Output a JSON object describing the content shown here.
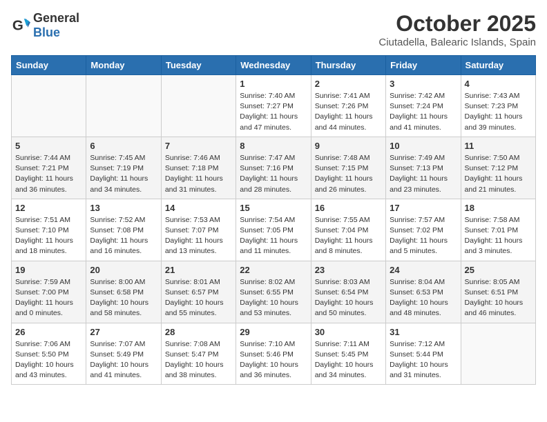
{
  "header": {
    "logo_general": "General",
    "logo_blue": "Blue",
    "month": "October 2025",
    "location": "Ciutadella, Balearic Islands, Spain"
  },
  "weekdays": [
    "Sunday",
    "Monday",
    "Tuesday",
    "Wednesday",
    "Thursday",
    "Friday",
    "Saturday"
  ],
  "weeks": [
    [
      {
        "day": "",
        "info": ""
      },
      {
        "day": "",
        "info": ""
      },
      {
        "day": "",
        "info": ""
      },
      {
        "day": "1",
        "info": "Sunrise: 7:40 AM\nSunset: 7:27 PM\nDaylight: 11 hours and 47 minutes."
      },
      {
        "day": "2",
        "info": "Sunrise: 7:41 AM\nSunset: 7:26 PM\nDaylight: 11 hours and 44 minutes."
      },
      {
        "day": "3",
        "info": "Sunrise: 7:42 AM\nSunset: 7:24 PM\nDaylight: 11 hours and 41 minutes."
      },
      {
        "day": "4",
        "info": "Sunrise: 7:43 AM\nSunset: 7:23 PM\nDaylight: 11 hours and 39 minutes."
      }
    ],
    [
      {
        "day": "5",
        "info": "Sunrise: 7:44 AM\nSunset: 7:21 PM\nDaylight: 11 hours and 36 minutes."
      },
      {
        "day": "6",
        "info": "Sunrise: 7:45 AM\nSunset: 7:19 PM\nDaylight: 11 hours and 34 minutes."
      },
      {
        "day": "7",
        "info": "Sunrise: 7:46 AM\nSunset: 7:18 PM\nDaylight: 11 hours and 31 minutes."
      },
      {
        "day": "8",
        "info": "Sunrise: 7:47 AM\nSunset: 7:16 PM\nDaylight: 11 hours and 28 minutes."
      },
      {
        "day": "9",
        "info": "Sunrise: 7:48 AM\nSunset: 7:15 PM\nDaylight: 11 hours and 26 minutes."
      },
      {
        "day": "10",
        "info": "Sunrise: 7:49 AM\nSunset: 7:13 PM\nDaylight: 11 hours and 23 minutes."
      },
      {
        "day": "11",
        "info": "Sunrise: 7:50 AM\nSunset: 7:12 PM\nDaylight: 11 hours and 21 minutes."
      }
    ],
    [
      {
        "day": "12",
        "info": "Sunrise: 7:51 AM\nSunset: 7:10 PM\nDaylight: 11 hours and 18 minutes."
      },
      {
        "day": "13",
        "info": "Sunrise: 7:52 AM\nSunset: 7:08 PM\nDaylight: 11 hours and 16 minutes."
      },
      {
        "day": "14",
        "info": "Sunrise: 7:53 AM\nSunset: 7:07 PM\nDaylight: 11 hours and 13 minutes."
      },
      {
        "day": "15",
        "info": "Sunrise: 7:54 AM\nSunset: 7:05 PM\nDaylight: 11 hours and 11 minutes."
      },
      {
        "day": "16",
        "info": "Sunrise: 7:55 AM\nSunset: 7:04 PM\nDaylight: 11 hours and 8 minutes."
      },
      {
        "day": "17",
        "info": "Sunrise: 7:57 AM\nSunset: 7:02 PM\nDaylight: 11 hours and 5 minutes."
      },
      {
        "day": "18",
        "info": "Sunrise: 7:58 AM\nSunset: 7:01 PM\nDaylight: 11 hours and 3 minutes."
      }
    ],
    [
      {
        "day": "19",
        "info": "Sunrise: 7:59 AM\nSunset: 7:00 PM\nDaylight: 11 hours and 0 minutes."
      },
      {
        "day": "20",
        "info": "Sunrise: 8:00 AM\nSunset: 6:58 PM\nDaylight: 10 hours and 58 minutes."
      },
      {
        "day": "21",
        "info": "Sunrise: 8:01 AM\nSunset: 6:57 PM\nDaylight: 10 hours and 55 minutes."
      },
      {
        "day": "22",
        "info": "Sunrise: 8:02 AM\nSunset: 6:55 PM\nDaylight: 10 hours and 53 minutes."
      },
      {
        "day": "23",
        "info": "Sunrise: 8:03 AM\nSunset: 6:54 PM\nDaylight: 10 hours and 50 minutes."
      },
      {
        "day": "24",
        "info": "Sunrise: 8:04 AM\nSunset: 6:53 PM\nDaylight: 10 hours and 48 minutes."
      },
      {
        "day": "25",
        "info": "Sunrise: 8:05 AM\nSunset: 6:51 PM\nDaylight: 10 hours and 46 minutes."
      }
    ],
    [
      {
        "day": "26",
        "info": "Sunrise: 7:06 AM\nSunset: 5:50 PM\nDaylight: 10 hours and 43 minutes."
      },
      {
        "day": "27",
        "info": "Sunrise: 7:07 AM\nSunset: 5:49 PM\nDaylight: 10 hours and 41 minutes."
      },
      {
        "day": "28",
        "info": "Sunrise: 7:08 AM\nSunset: 5:47 PM\nDaylight: 10 hours and 38 minutes."
      },
      {
        "day": "29",
        "info": "Sunrise: 7:10 AM\nSunset: 5:46 PM\nDaylight: 10 hours and 36 minutes."
      },
      {
        "day": "30",
        "info": "Sunrise: 7:11 AM\nSunset: 5:45 PM\nDaylight: 10 hours and 34 minutes."
      },
      {
        "day": "31",
        "info": "Sunrise: 7:12 AM\nSunset: 5:44 PM\nDaylight: 10 hours and 31 minutes."
      },
      {
        "day": "",
        "info": ""
      }
    ]
  ]
}
